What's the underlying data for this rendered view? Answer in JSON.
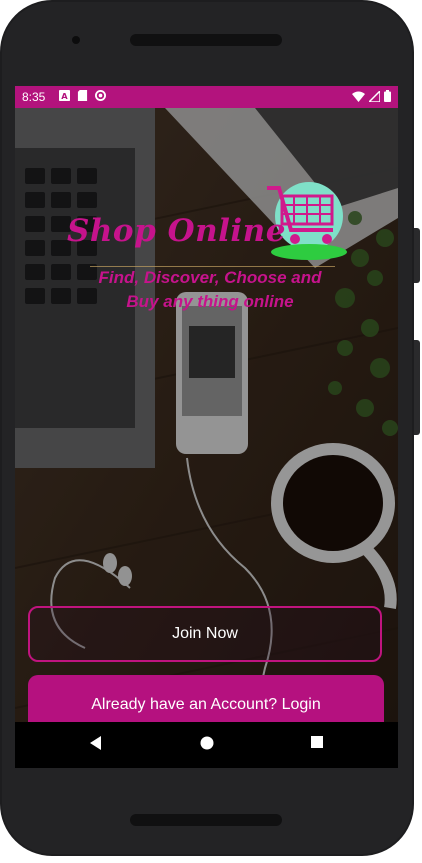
{
  "status_bar": {
    "time": "8:35",
    "icons": [
      "a-box-icon",
      "sd-card-icon",
      "sync-icon"
    ],
    "right_icons": [
      "wifi-icon",
      "signal-icon",
      "battery-icon"
    ]
  },
  "app": {
    "logo_text": "Shop Online",
    "tagline": "Find, Discover, Choose and Buy any thing online",
    "join_button": "Join Now",
    "login_button": "Already have an Account? Login",
    "accent_color": "#b5117f"
  },
  "nav_bar": {
    "items": [
      "back-icon",
      "home-icon",
      "recents-icon"
    ]
  }
}
